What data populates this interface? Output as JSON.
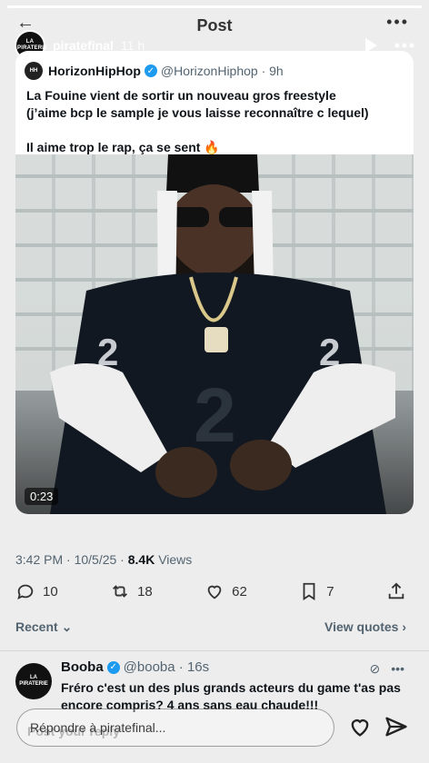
{
  "background": {
    "title": "Post",
    "back_glyph": "←",
    "more_glyph": "•••",
    "post_meta": {
      "time": "3:42 PM · 10/5/25 · ",
      "views_count": "8.4K",
      "views_label": " Views"
    },
    "stats": {
      "replies": "10",
      "reposts": "18",
      "likes": "62",
      "bookmarks": "7"
    },
    "recent_label": "Recent",
    "view_quotes_label": "View quotes",
    "post_your_reply_ghost": "Post your reply"
  },
  "story": {
    "progress": 1.0,
    "username": "piratefinal",
    "time": "11 h",
    "avatar_text": "LA PIRATERIE",
    "reply_placeholder": "Répondre à piratefinal..."
  },
  "tweet": {
    "avatar_text": "HH",
    "name": "HorizonHipHop",
    "handle": "@HorizonHiphop · 9h",
    "text": "La Fouine vient de sortir un nouveau gros freestyle\n(j’aime bcp le sample je vous laisse reconnaître c lequel)\n\nIl aime trop le rap, ça se sent 🔥",
    "video_time": "0:23"
  },
  "reply_tweet": {
    "avatar_text": "LA PIRATERIE",
    "name": "Booba",
    "handle": "@booba · 16s",
    "text": "Fréro c'est un des plus grands acteurs du game t'as pas encore compris? 4 ans sans eau chaude!!!"
  },
  "colors": {
    "verified": "#1d9bf0",
    "card_bg": "#ffffff",
    "muted": "#536471"
  }
}
